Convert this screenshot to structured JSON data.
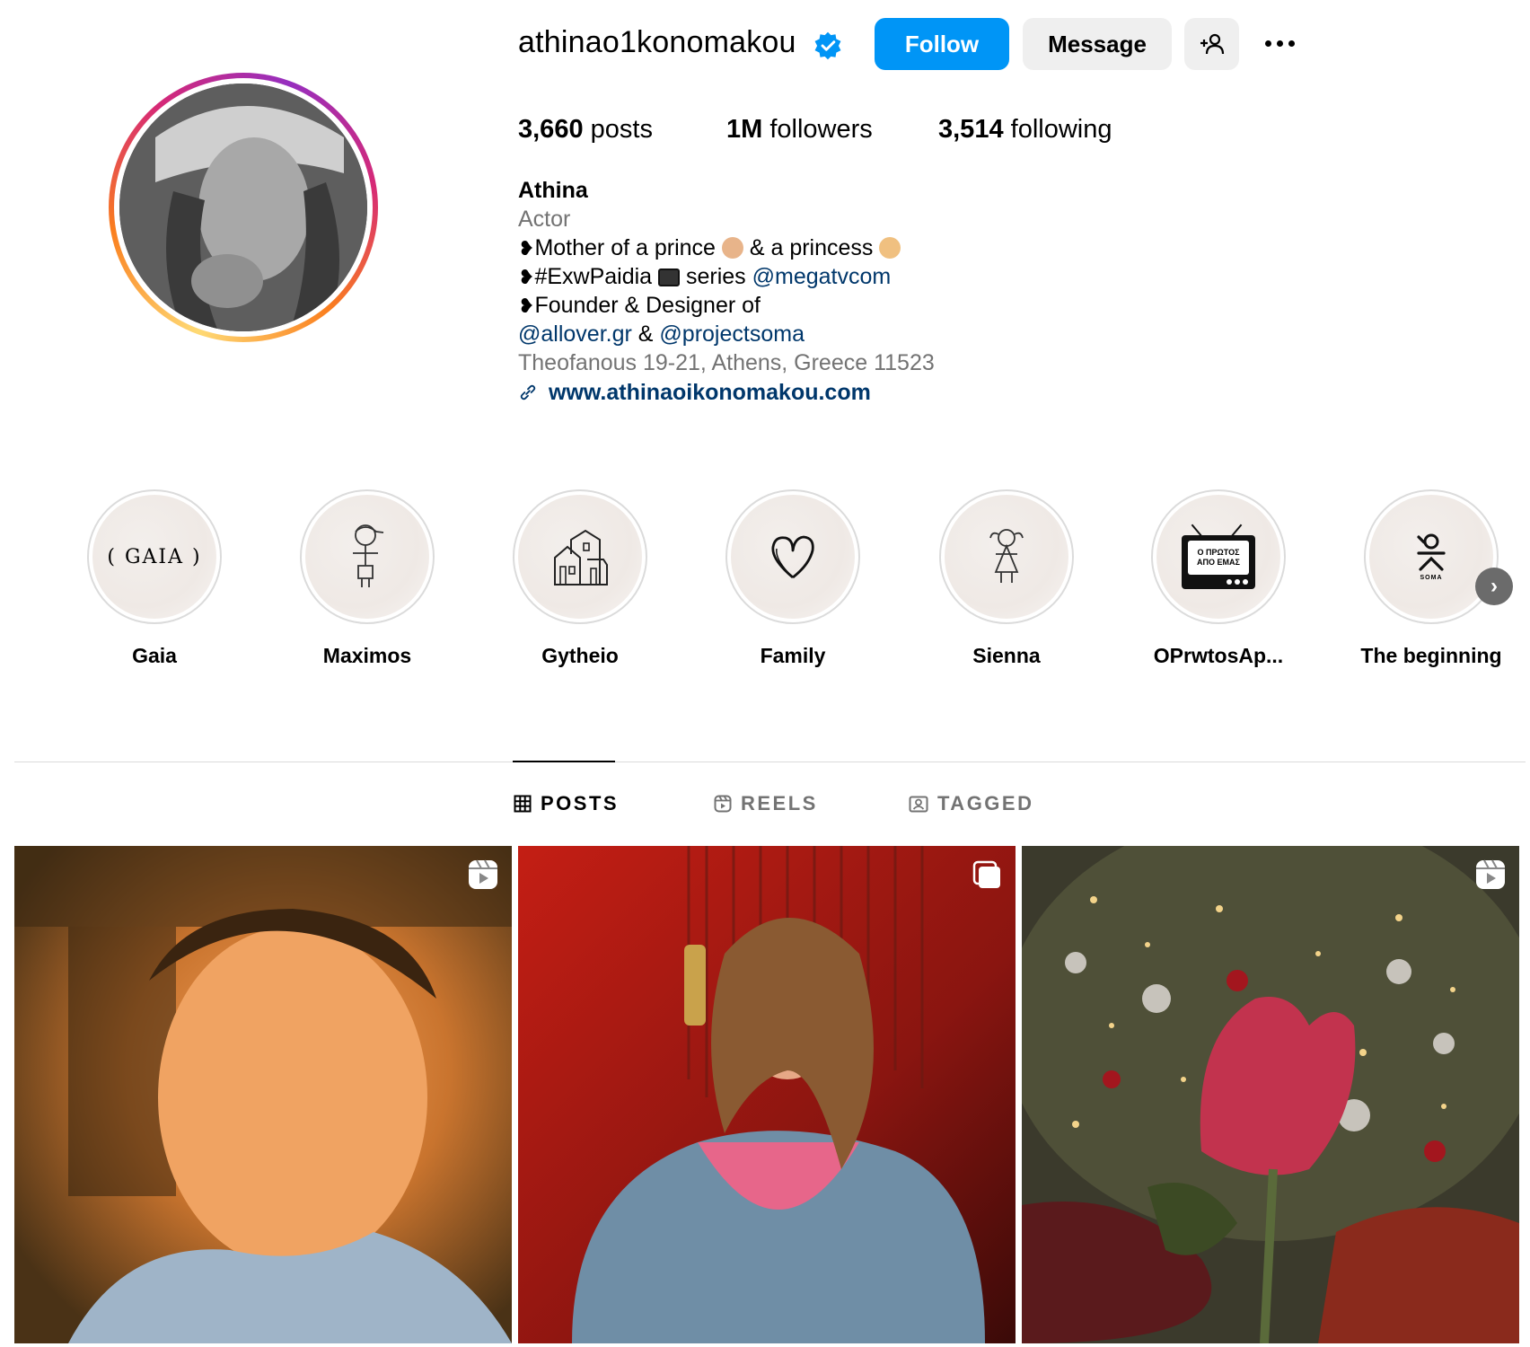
{
  "profile": {
    "username": "athinao1konomakou",
    "verified": true,
    "follow_label": "Follow",
    "message_label": "Message",
    "stats": {
      "posts_count": "3,660",
      "posts_label": "posts",
      "followers_count": "1M",
      "followers_label": "followers",
      "following_count": "3,514",
      "following_label": "following"
    },
    "bio": {
      "name": "Athina",
      "category": "Actor",
      "line1_prefix": "Mother of a prince",
      "line1_mid": "& a princess",
      "line2_prefix": "#ExwPaidia",
      "line2_mid": "series",
      "line2_mention": "@megatvcom",
      "line3": "Founder & Designer of",
      "line4_mention1": "@allover.gr",
      "line4_amp": "&",
      "line4_mention2": "@projectsoma",
      "address": "Theofanous 19-21, Athens, Greece 11523",
      "website": "www.athinaoikonomakou.com"
    }
  },
  "highlights": [
    {
      "label": "Gaia",
      "cover_text": "( GAIA )"
    },
    {
      "label": "Maximos"
    },
    {
      "label": "Gytheio"
    },
    {
      "label": "Family"
    },
    {
      "label": "Sienna"
    },
    {
      "label": "OPrwtosAp...",
      "cover_text_line1": "Ο ΠΡΩΤΟΣ",
      "cover_text_line2": "ΑΠΟ ΕΜΑΣ"
    },
    {
      "label": "The beginning",
      "cover_text": "SOMA"
    }
  ],
  "tabs": [
    {
      "label": "POSTS",
      "icon": "grid-icon",
      "active": true
    },
    {
      "label": "REELS",
      "icon": "reels-icon",
      "active": false
    },
    {
      "label": "TAGGED",
      "icon": "tagged-icon",
      "active": false
    }
  ],
  "posts": [
    {
      "type": "reel",
      "icon": "reel-icon"
    },
    {
      "type": "carousel",
      "icon": "carousel-icon"
    },
    {
      "type": "reel",
      "icon": "reel-icon"
    }
  ],
  "colors": {
    "accent": "#0095f6",
    "link": "#00376b",
    "muted": "#737373",
    "button_bg": "#efefef"
  }
}
